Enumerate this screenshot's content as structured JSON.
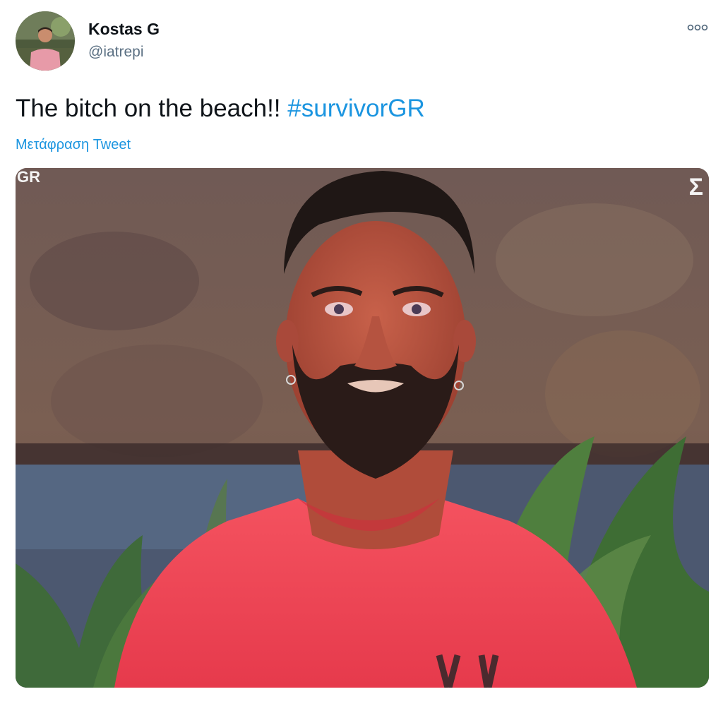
{
  "author": {
    "name": "Kostas G",
    "handle": "@iatrepi",
    "avatar_icon": "user-avatar-photo"
  },
  "menu": {
    "more_icon": "more-horizontal-icon"
  },
  "tweet": {
    "text": "The bitch on the beach!! ",
    "hashtag": "#survivorGR",
    "translate_label": "Μετάφραση Tweet"
  },
  "media": {
    "kind": "tv-screen-photo",
    "overlay_left": "GR",
    "overlay_right": "Σ"
  },
  "colors": {
    "text": "#0f1419",
    "secondary": "#5b7083",
    "link": "#1b95e0"
  }
}
